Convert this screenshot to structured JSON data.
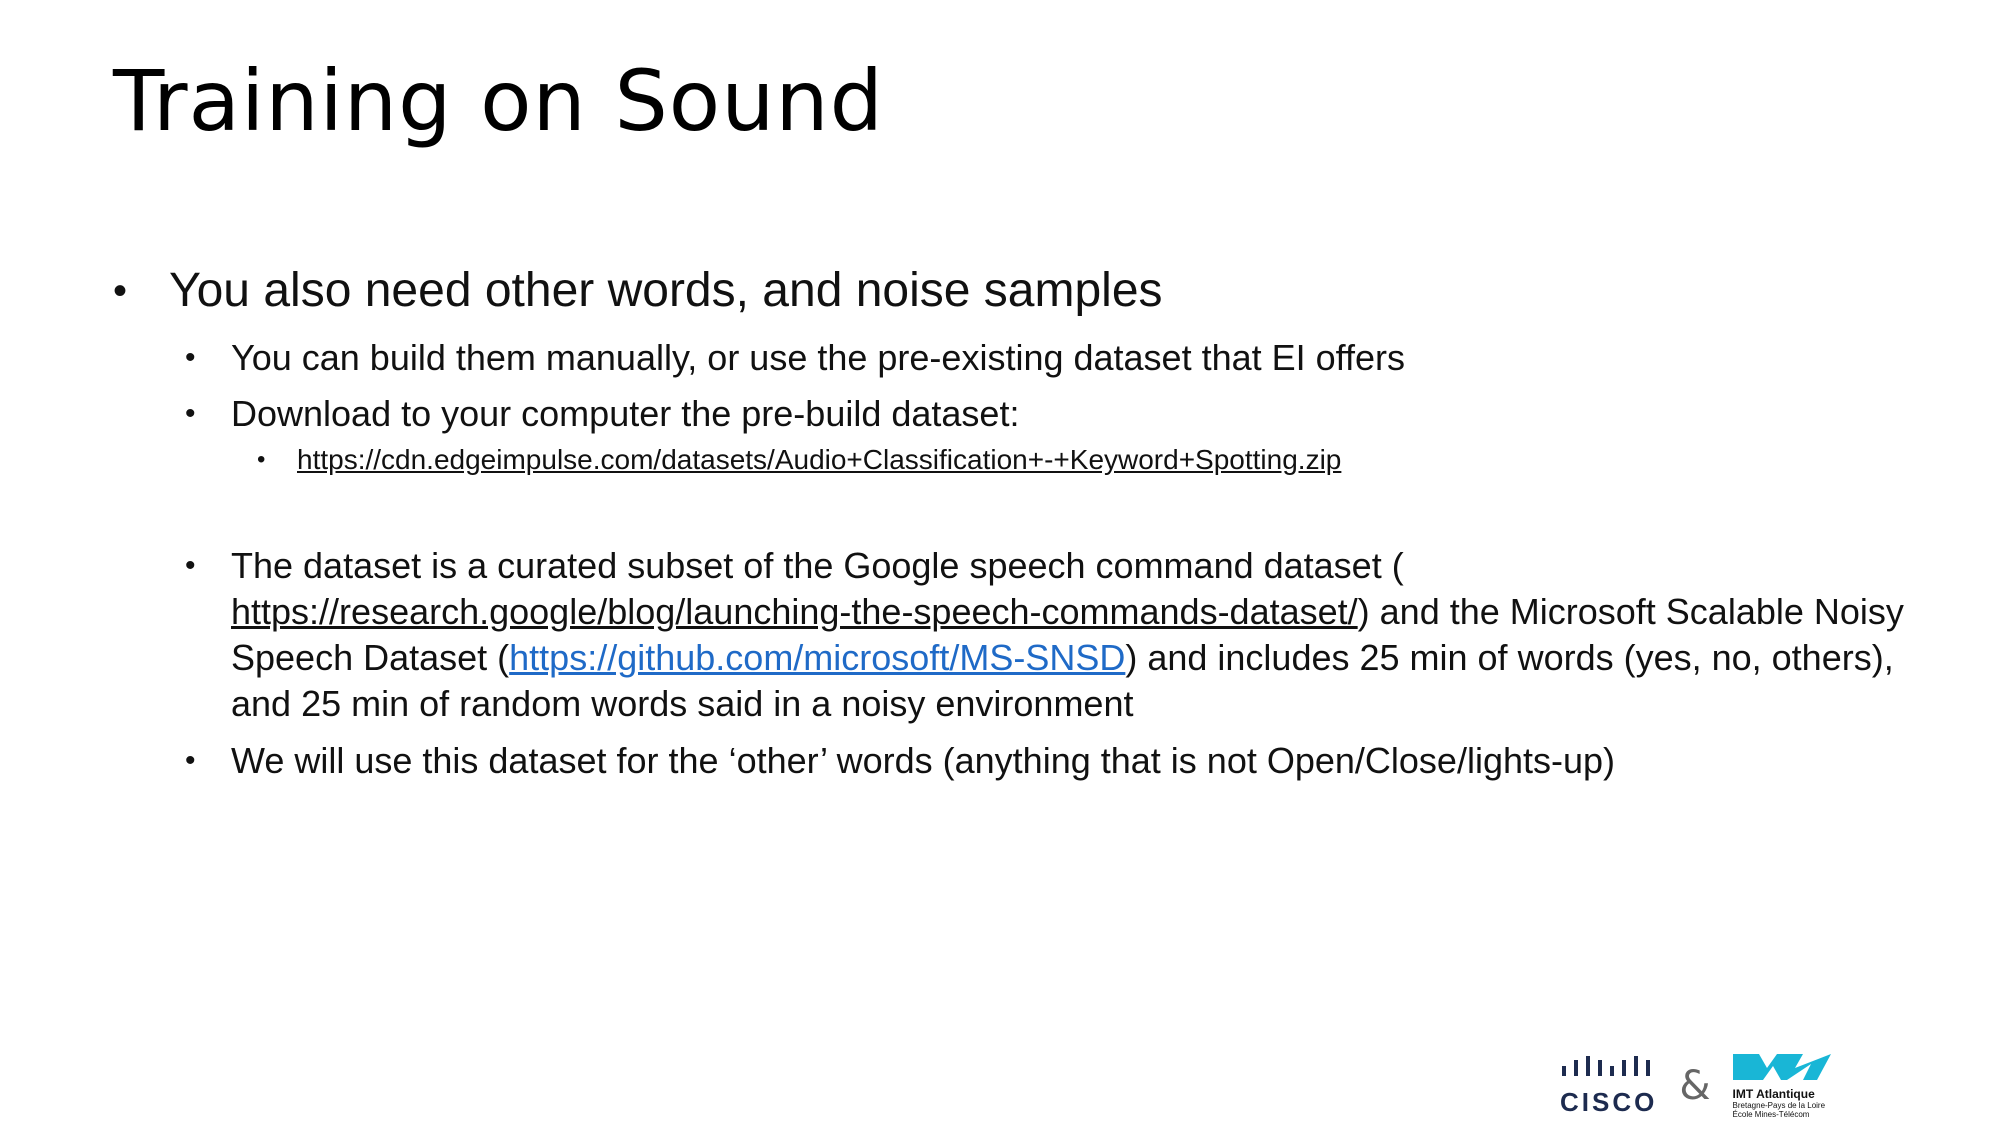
{
  "title": "Training on Sound",
  "bullets": {
    "main": "You also need other words, and noise samples",
    "sub1": "You can build them manually, or use the pre-existing dataset that EI offers",
    "sub2": "Download to your computer the pre-build dataset:",
    "sub2_link": "https://cdn.edgeimpulse.com/datasets/Audio+Classification+-+Keyword+Spotting.zip",
    "sub3_part1": "The dataset is a curated subset of the Google speech command dataset (",
    "sub3_link1": "https://research.google/blog/launching-the-speech-commands-dataset/",
    "sub3_part2": ") and the Microsoft Scalable Noisy Speech Dataset (",
    "sub3_link2": "https://github.com/microsoft/MS-SNSD",
    "sub3_part3": ") and includes 25 min of words (yes, no, others), and 25 min of random words said in a noisy environment",
    "sub4": "We will use this dataset for the ‘other’ words (anything that is not Open/Close/lights-up)"
  },
  "footer": {
    "cisco_text": "CISCO",
    "ampersand": "&",
    "imt_name": "IMT Atlantique",
    "imt_line1": "Bretagne-Pays de la Loire",
    "imt_line2": "École Mines-Télécom"
  },
  "colors": {
    "link_blue": "#1f6ac7",
    "cisco_navy": "#1d2b4f",
    "imt_cyan": "#19b6d6"
  }
}
